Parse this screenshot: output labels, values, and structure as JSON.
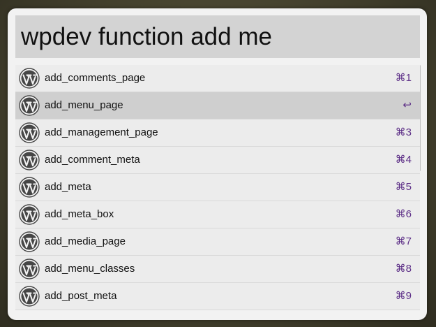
{
  "search": {
    "query": "wpdev function add me"
  },
  "results": [
    {
      "label": "add_comments_page",
      "shortcut": "⌘1",
      "selected": false
    },
    {
      "label": "add_menu_page",
      "shortcut": "↩",
      "selected": true
    },
    {
      "label": "add_management_page",
      "shortcut": "⌘3",
      "selected": false
    },
    {
      "label": "add_comment_meta",
      "shortcut": "⌘4",
      "selected": false
    },
    {
      "label": "add_meta",
      "shortcut": "⌘5",
      "selected": false
    },
    {
      "label": "add_meta_box",
      "shortcut": "⌘6",
      "selected": false
    },
    {
      "label": "add_media_page",
      "shortcut": "⌘7",
      "selected": false
    },
    {
      "label": "add_menu_classes",
      "shortcut": "⌘8",
      "selected": false
    },
    {
      "label": "add_post_meta",
      "shortcut": "⌘9",
      "selected": false
    }
  ],
  "icon": "wordpress-icon"
}
